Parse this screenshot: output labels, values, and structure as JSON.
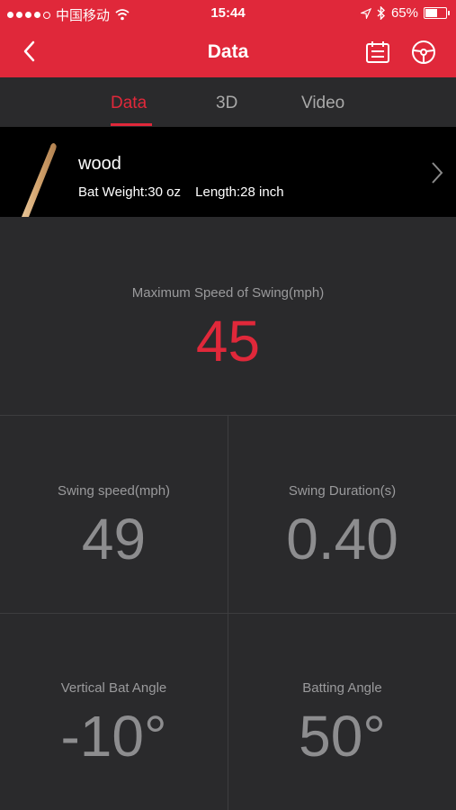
{
  "status_bar": {
    "carrier": "中国移动",
    "time": "15:44",
    "battery_percent": "65%",
    "battery_level": 0.65
  },
  "nav": {
    "title": "Data"
  },
  "tabs": [
    {
      "label": "Data",
      "active": true
    },
    {
      "label": "3D",
      "active": false
    },
    {
      "label": "Video",
      "active": false
    }
  ],
  "bat": {
    "name": "wood",
    "weight": "Bat Weight:30 oz",
    "length": "Length:28 inch"
  },
  "metrics": {
    "max_speed": {
      "label": "Maximum Speed of Swing(mph)",
      "value": "45"
    },
    "swing_speed": {
      "label": "Swing speed(mph)",
      "value": "49"
    },
    "swing_duration": {
      "label": "Swing Duration(s)",
      "value": "0.40"
    },
    "vertical_angle": {
      "label": "Vertical Bat Angle",
      "value": "-10°"
    },
    "batting_angle": {
      "label": "Batting Angle",
      "value": "50°"
    }
  },
  "colors": {
    "accent": "#e0283a",
    "background": "#2a2a2c",
    "bat_row": "#000000"
  }
}
